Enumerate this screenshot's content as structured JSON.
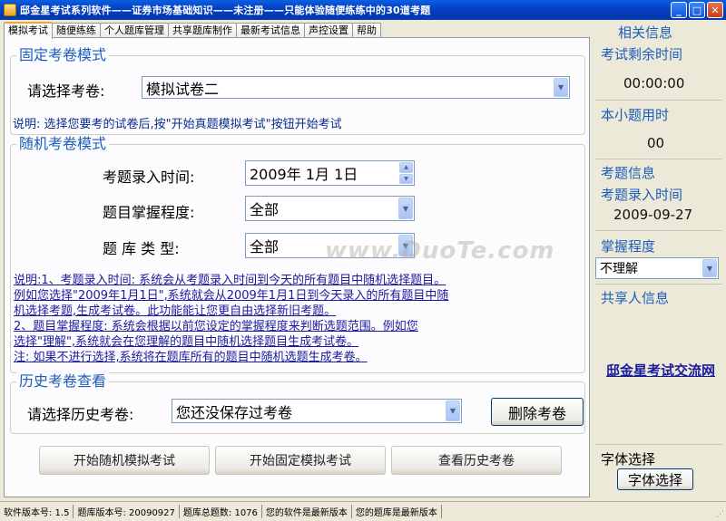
{
  "window": {
    "title": "邸金星考试系列软件——证券市场基础知识——未注册——只能体验随便练练中的30道考题",
    "minimize": "_",
    "maximize": "□",
    "close": "✕"
  },
  "tabs": [
    "模拟考试",
    "随便练练",
    "个人题库管理",
    "共享题库制作",
    "最新考试信息",
    "声控设置",
    "帮助"
  ],
  "fixed_mode": {
    "title": "固定考卷模式",
    "select_label": "请选择考卷:",
    "selected_paper": "模拟试卷二",
    "note": "说明: 选择您要考的试卷后,按\"开始真题模拟考试\"按钮开始考试"
  },
  "random_mode": {
    "title": "随机考卷模式",
    "date_label": "考题录入时间:",
    "date_value": "2009年  1月  1日",
    "mastery_label": "题目掌握程度:",
    "mastery_value": "全部",
    "bank_label": "题 库 类 型:",
    "bank_value": "全部",
    "description": [
      "说明:1、考题录入时间: 系统会从考题录入时间到今天的所有题目中随机选择题目。",
      "例如您选择\"2009年1月1日\",系统就会从2009年1月1日到今天录入的所有题目中随",
      "机选择考题,生成考试卷。此功能能让您更自由选择新旧考题。",
      "    2、题目掌握程度: 系统会根据以前您设定的掌握程度来判断选题范围。例如您",
      "选择\"理解\",系统就会在您理解的题目中随机选择题目生成考试卷。",
      "注: 如果不进行选择,系统将在题库所有的题目中随机选题生成考卷。"
    ],
    "watermark": "www.DuoTe.com"
  },
  "history": {
    "title": "历史考卷查看",
    "select_label": "请选择历史考卷:",
    "selected": "您还没保存过考卷",
    "delete_button": "删除考卷"
  },
  "actions": {
    "start_random": "开始随机模拟考试",
    "start_fixed": "开始固定模拟考试",
    "view_history": "查看历史考卷"
  },
  "sidebar": {
    "related_info": "相关信息",
    "remaining_time_label": "考试剩余时间",
    "remaining_time": "00:00:00",
    "question_time_label": "本小题用时",
    "question_time": "00",
    "question_info_label": "考题信息",
    "entry_time_label": "考题录入时间",
    "entry_time": "2009-09-27",
    "mastery_label": "掌握程度",
    "mastery_value": "不理解",
    "sharer_label": "共享人信息",
    "link": "邸金星考试交流网",
    "font_label": "字体选择",
    "font_button": "字体选择"
  },
  "statusbar": {
    "software_version": "软件版本号: 1.5",
    "bank_version": "题库版本号: 20090927",
    "total_questions": "题库总题数: 1076",
    "software_status": "您的软件是最新版本",
    "bank_status": "您的题库是最新版本"
  }
}
